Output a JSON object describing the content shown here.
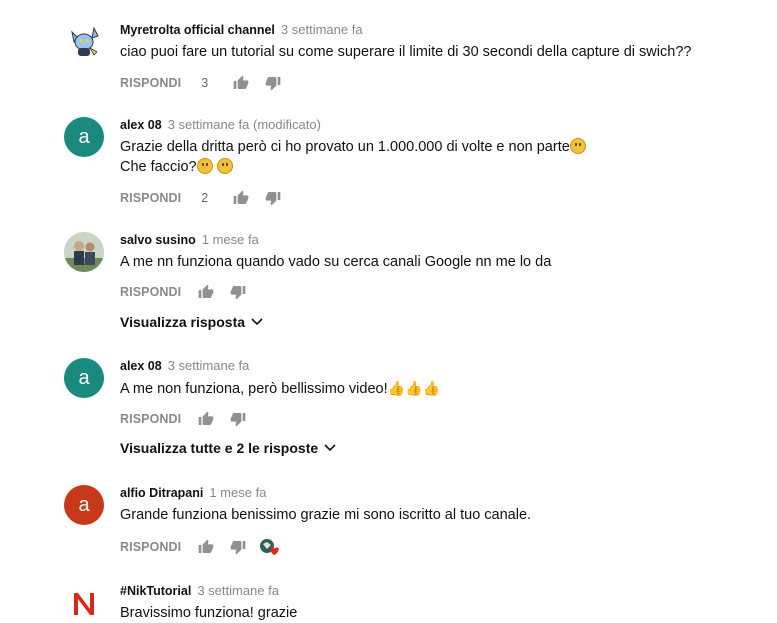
{
  "comments": [
    {
      "author": "Myretrolta official channel",
      "time": "3 settimane fa",
      "text": "ciao puoi fare un tutorial su come superare il limite di 30 secondi della capture di swich??",
      "reply_label": "RISPONDI",
      "likes": "3",
      "avatar_icon": "pokemon-avatar-icon"
    },
    {
      "author": "alex 08",
      "time": "3 settimane fa (modificato)",
      "text_line1": "Grazie della dritta però ci ho provato un 1.000.000 di volte e non parte",
      "text_line2": "Che faccio?",
      "reply_label": "RISPONDI",
      "likes": "2",
      "avatar_letter": "a",
      "avatar_color": "#1a8a7e"
    },
    {
      "author": "salvo susino",
      "time": "1 mese fa",
      "text": "A me nn funziona quando vado su cerca canali Google nn me lo da",
      "reply_label": "RISPONDI",
      "view_replies": "Visualizza risposta"
    },
    {
      "author": "alex 08",
      "time": "3 settimane fa",
      "text": "A me non funziona, però bellissimo video!",
      "reply_label": "RISPONDI",
      "avatar_letter": "a",
      "avatar_color": "#1a8a7e",
      "view_replies": "Visualizza tutte e 2 le risposte"
    },
    {
      "author": "alfio Ditrapani",
      "time": "1 mese fa",
      "text": "Grande funziona benissimo grazie mi sono iscritto al tuo canale.",
      "reply_label": "RISPONDI",
      "avatar_letter": "a",
      "avatar_color": "#c8391b"
    },
    {
      "author": "#NikTutorial",
      "time": "3 settimane fa",
      "text": "Bravissimo funziona! grazie",
      "avatar_color": "#d42a1c"
    }
  ]
}
